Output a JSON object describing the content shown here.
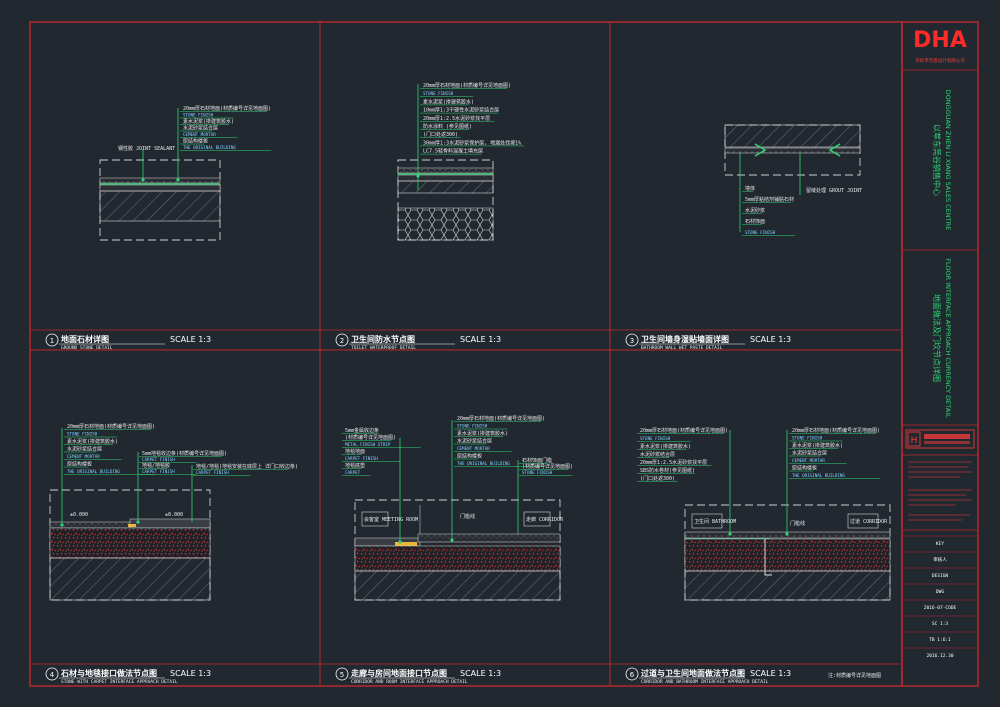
{
  "brand": {
    "logo": "DHA",
    "subtitle": "深圳市杰恩设计有限公司"
  },
  "colors": {
    "frame": "#c0282e",
    "leader": "#2ed573",
    "text": "#e8e8e8",
    "stone": "#c8c8c8",
    "concrete": "#b01f28"
  },
  "project": {
    "name_cn": "以萃东莞谷销售中心",
    "name_en": "DONGGUAN ZHEN LI XIANG SALES CENTRE",
    "drawing_cn": "地面做法及门坎节点详图",
    "drawing_en": "FLOOR INTERFACE APPROACH CURRENCY DETAIL"
  },
  "details": [
    {
      "num": "1",
      "title": "地面石材详图",
      "scale": "SCALE 1:3",
      "subtitle": "GROUND STONE DETAIL",
      "notes": [
        "20mm厚石材地面(材质编号详见地面图)",
        "STONE FINISH",
        "素水泥浆(掺建筑胶水)",
        "水泥砂浆结合层",
        "CEMENT MORTAR",
        "原结构楼板",
        "THE ORIGINAL BUILDING"
      ],
      "side_label": "钢性胶 JOINT SEALANT"
    },
    {
      "num": "2",
      "title": "卫生间防水节点图",
      "scale": "SCALE 1:3",
      "subtitle": "TOILET WATERPROOF DETAIL",
      "notes": [
        "20mm厚石材地面(材质编号详见地面图)",
        "STONE FINISH",
        "素水泥浆(掺建筑胶水)",
        "10mm厚1:3干硬性水泥砂浆结合层",
        "20mm厚1:2.5水泥砂浆找平层",
        "防水涂料 (参见图纸)",
        "(门口处返300)",
        "30mm厚1:3水泥砂浆保护层, 地漏处找坡1%",
        "LC7.5轻骨料混凝土填充层"
      ]
    },
    {
      "num": "3",
      "title": "卫生间墙身湿贴墙面详图",
      "scale": "SCALE 1:3",
      "subtitle": "BATHROOM WALL WET PASTE DETAIL",
      "notes": [
        "墙体",
        "5mm厚粘结剂铺贴石材",
        "水泥砂浆",
        "石材饰面",
        "STONE FINISH"
      ],
      "side_label": "留缝处理 GROUT JOINT"
    },
    {
      "num": "4",
      "title": "石材与地毯接口做法节点图",
      "scale": "SCALE 1:3",
      "subtitle": "STONE WITH CARPET INTERFACE APPROACH DETAIL",
      "notes": [
        "20mm厚石材地面(材质编号详见地面图)",
        "STONE FINISH",
        "素水泥浆(掺建筑胶水)",
        "水泥砂浆结合层",
        "CEMENT MORTAR",
        "原结构楼板",
        "THE ORIGINAL BUILDING"
      ],
      "mid_notes": [
        "5mm地毯收边条(材质编号详见地面图)",
        "CARPET FINISH",
        "地毯/地毯胶",
        "CARPET FINISH"
      ],
      "right_notes": [
        "地毯/地毯(地毯安装在底层上 详门口收边条)",
        "CARPET FINISH"
      ],
      "elev_left": "±0.000",
      "elev_right": "±0.000"
    },
    {
      "num": "5",
      "title": "走廊与房间地面接口节点图",
      "scale": "SCALE 1:3",
      "subtitle": "CORRIDOR AND ROOM INTERFACE APPROACH DETAIL",
      "notes": [
        "20mm厚石材地面(材质编号详见地面图)",
        "STONE FINISH",
        "素水泥浆(掺建筑胶水)",
        "水泥砂浆结合层",
        "CEMENT MORTAR",
        "原结构楼板",
        "THE ORIGINAL BUILDING"
      ],
      "left_notes": [
        "5mm金属收边条",
        "(材质编号详见地面图)",
        "METAL FINISH STRIP",
        "地毯地面",
        "CARPET FINISH",
        "地毯底垫",
        "CARPET"
      ],
      "right_notes": [
        "石材饰面门槛",
        "(材质编号详见地面图)",
        "STONE FINISH"
      ],
      "room_left": "会客室 MEETING ROOM",
      "room_right": "走廊 CORRIDOR",
      "door": "门槛线"
    },
    {
      "num": "6",
      "title": "过道与卫生间地面做法节点图",
      "scale": "SCALE 1:3",
      "subtitle": "CORRIDOR AND BATHROOM INTERFACE APPROACH DETAIL",
      "notes": [
        "20mm厚石材地面(材质编号详见地面图)",
        "STONE FINISH",
        "素水泥浆(掺建筑胶水)",
        "水泥砂浆结合层",
        "CEMENT MORTAR",
        "原结构楼板",
        "THE ORIGINAL BUILDING"
      ],
      "left_notes": [
        "20mm厚石材地面(材质编号详见地面图)",
        "STONE FINISH",
        "素水泥浆(掺建筑胶水)",
        "水泥砂浆结合层",
        "20mm厚1:2.5水泥砂浆找平层",
        "SBS防水卷材(参见图纸)",
        "(门口处返300)"
      ],
      "room_left": "卫生间 BATHROOM",
      "room_right": "过道 CORRIDOR",
      "door": "门槛线",
      "footnote": "注:材质编号详见地面图"
    }
  ],
  "titleblock": {
    "rows": [
      "KEY",
      "审核人",
      "DESIGN",
      "DWG",
      "2016-07-CODE",
      "SC 1:3",
      "TB 1:6:1",
      "2016.12.30"
    ]
  }
}
